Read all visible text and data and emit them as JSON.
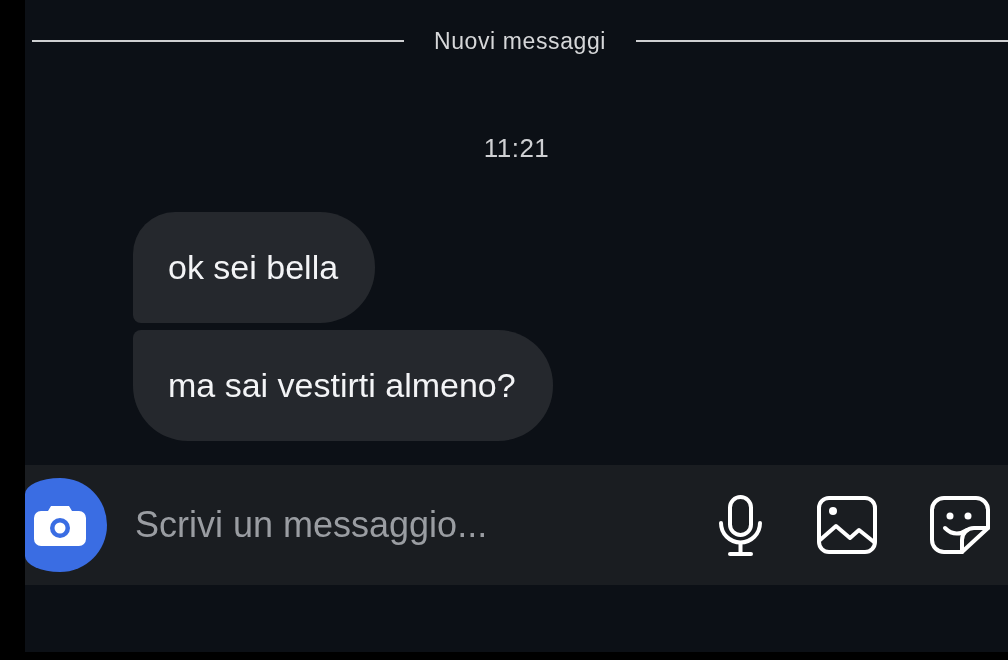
{
  "divider": {
    "label": "Nuovi messaggi"
  },
  "timestamp": "11:21",
  "messages": [
    {
      "text": "ok sei bella"
    },
    {
      "text": "ma sai vestirti almeno?"
    }
  ],
  "composer": {
    "placeholder": "Scrivi un messaggio..."
  }
}
